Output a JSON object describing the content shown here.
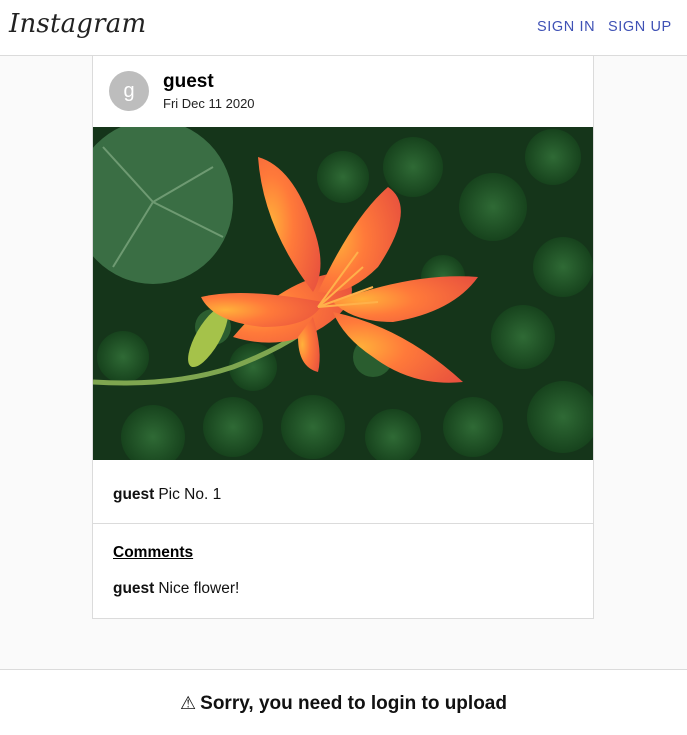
{
  "header": {
    "logo": "Instagram",
    "sign_in": "SIGN IN",
    "sign_up": "SIGN UP"
  },
  "post": {
    "avatar_letter": "g",
    "username": "guest",
    "date": "Fri Dec 11 2020",
    "image_icon": "orange-lily-flower-photo",
    "caption_user": "guest",
    "caption_text": "Pic No. 1",
    "comments_title": "Comments",
    "comments": [
      {
        "user": "guest",
        "text": "Nice flower!"
      }
    ]
  },
  "footer": {
    "warning_icon": "warning-icon",
    "message": "Sorry, you need to login to upload"
  },
  "colors": {
    "accent": "#3f51b5",
    "avatar_bg": "#bdbdbd",
    "page_bg": "#fafafa",
    "border": "#dbdbdb"
  }
}
